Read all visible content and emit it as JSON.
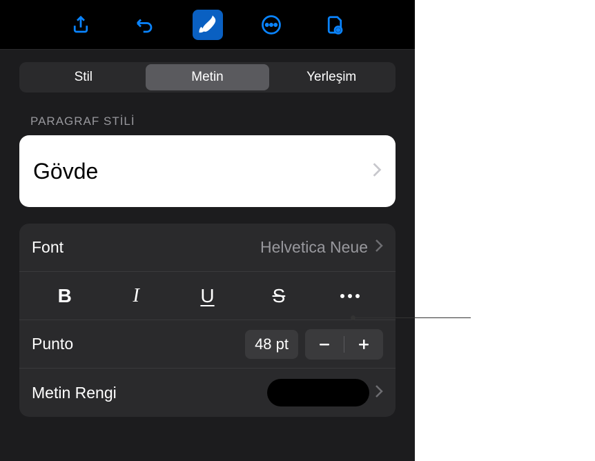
{
  "tabs": {
    "style": "Stil",
    "text": "Metin",
    "arrange": "Yerleşim"
  },
  "paragraph": {
    "section_label": "PARAGRAF STİLİ",
    "style_name": "Gövde"
  },
  "font": {
    "label": "Font",
    "value": "Helvetica Neue"
  },
  "format": {
    "bold": "B",
    "italic": "I",
    "underline": "U",
    "strike": "S"
  },
  "size": {
    "label": "Punto",
    "value": "48 pt"
  },
  "text_color": {
    "label": "Metin Rengi"
  }
}
